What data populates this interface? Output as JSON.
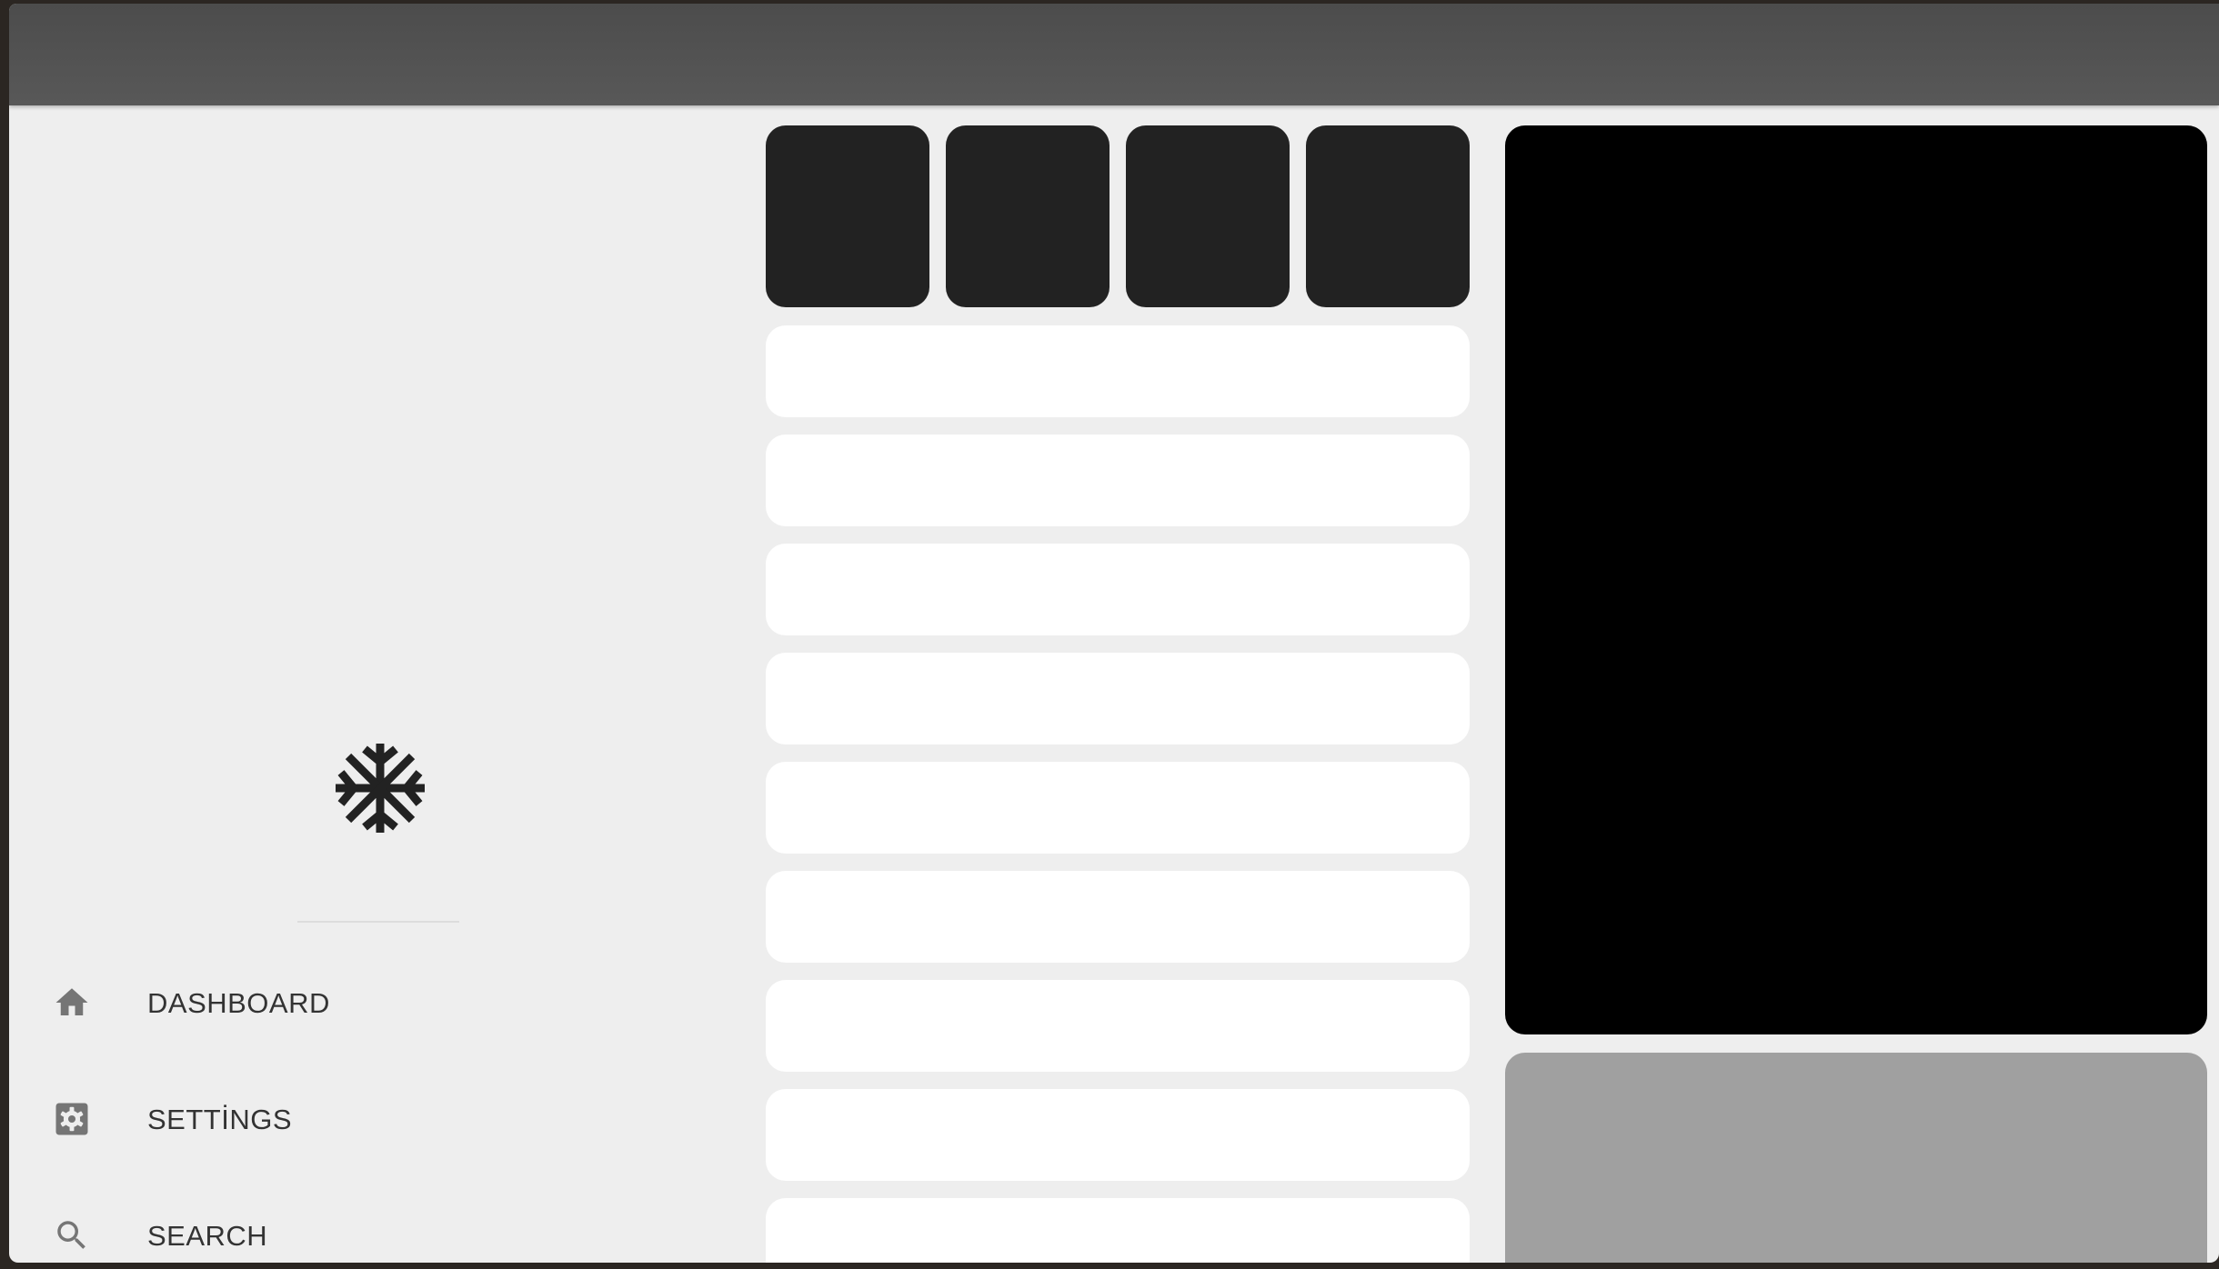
{
  "nav": {
    "items": [
      {
        "label": "DASHBOARD",
        "icon": "home-icon"
      },
      {
        "label": "SETTİNGS",
        "icon": "gear-icon"
      },
      {
        "label": "SEARCH",
        "icon": "search-icon"
      }
    ]
  },
  "logo": {
    "icon": "asterisk-icon"
  },
  "tiles": {
    "count": 4
  },
  "list": {
    "rows": 9
  },
  "colors": {
    "titlebar": "#555555",
    "background": "#eeeeee",
    "tile": "#222222",
    "row": "#ffffff",
    "preview": "#000000",
    "secondary_panel": "#a0a0a0",
    "icon": "#757575"
  }
}
